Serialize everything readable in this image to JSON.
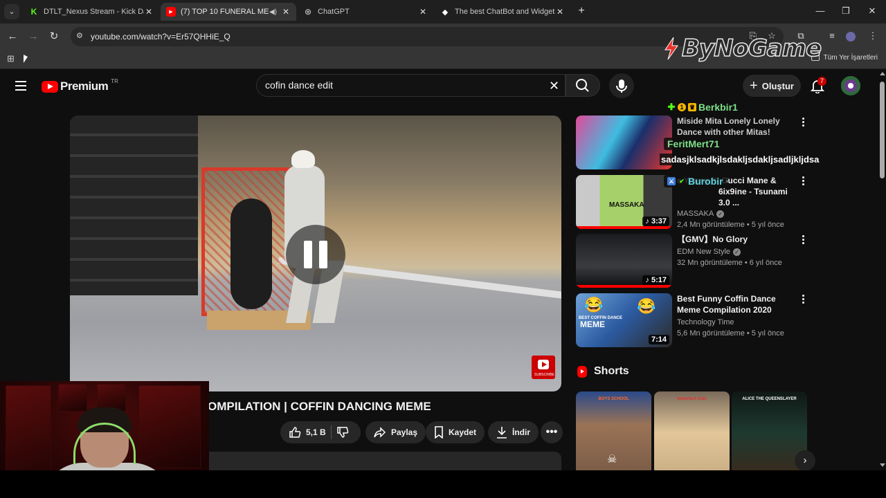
{
  "browser": {
    "tabs": [
      {
        "title": "DTLT_Nexus Stream - Kick Dash",
        "active": false
      },
      {
        "title": "(7) TOP 10 FUNERAL MEME",
        "active": true
      },
      {
        "title": "ChatGPT",
        "active": false
      },
      {
        "title": "The best ChatBot and Widgets",
        "active": false
      }
    ],
    "url": "youtube.com/watch?v=Er57QHHiE_Q",
    "all_bookmarks_label": "Tüm Yer İşaretleri",
    "watermark": "ByNoGame"
  },
  "youtube": {
    "logo_text": "Premium",
    "country_code": "TR",
    "search_query": "cofin dance edit",
    "create_label": "Oluştur",
    "notification_count": "7",
    "video": {
      "title_visible": "OMPILATION | COFFIN DANCING MEME",
      "likes": "5,1 B",
      "share_label": "Paylaş",
      "save_label": "Kaydet",
      "download_label": "İndir",
      "subscribe_caption": "SUBSCRIBE",
      "state": "paused"
    },
    "recommendations": [
      {
        "title": "Miside Mita Lonely Lonely Dance with other Mitas!",
        "channel": "",
        "meta": "",
        "duration": "",
        "progress": 0
      },
      {
        "title": "e Young ft. Gucci Mane & 6ix9ine - Tsunami 3.0 ...",
        "channel": "MASSAKA",
        "meta": "2,4 Mn görüntüleme • 5 yıl önce",
        "duration": "3:37",
        "progress": 1
      },
      {
        "title": "【GMV】No Glory",
        "channel": "EDM New Style",
        "meta": "32 Mn görüntüleme • 6 yıl önce",
        "duration": "5:17",
        "progress": 1
      },
      {
        "title": "Best Funny Coffin Dance Meme Compilation 2020",
        "channel": "Technology Time",
        "meta": "5,6 Mn görüntüleme • 5 yıl önce",
        "duration": "7:14",
        "progress": 0
      }
    ],
    "thumb_text": {
      "rec2": "MASSAKA",
      "rec4": "MEME",
      "rec4_top": "BEST COFFIN DANCE"
    },
    "shorts_label": "Shorts",
    "shorts": [
      {
        "caption": "BOYS SCHOOL"
      },
      {
        "caption": "Important Cats"
      },
      {
        "caption": "ALICE THE QUEENSLAYER"
      }
    ]
  },
  "chat_overlay": [
    {
      "user": "Berkbir1",
      "color": "#7ee08a"
    },
    {
      "user": "FeritMert71",
      "color": "#7ee08a"
    },
    {
      "user": "Burobir",
      "color": "#5fd4e0"
    }
  ],
  "chat_message": "sadasjklsadkjlsdakljsdakljsadljkljdsa",
  "colors": {
    "youtube_red": "#ff0000",
    "background": "#0f0f0f",
    "chrome_toolbar": "#353535"
  }
}
